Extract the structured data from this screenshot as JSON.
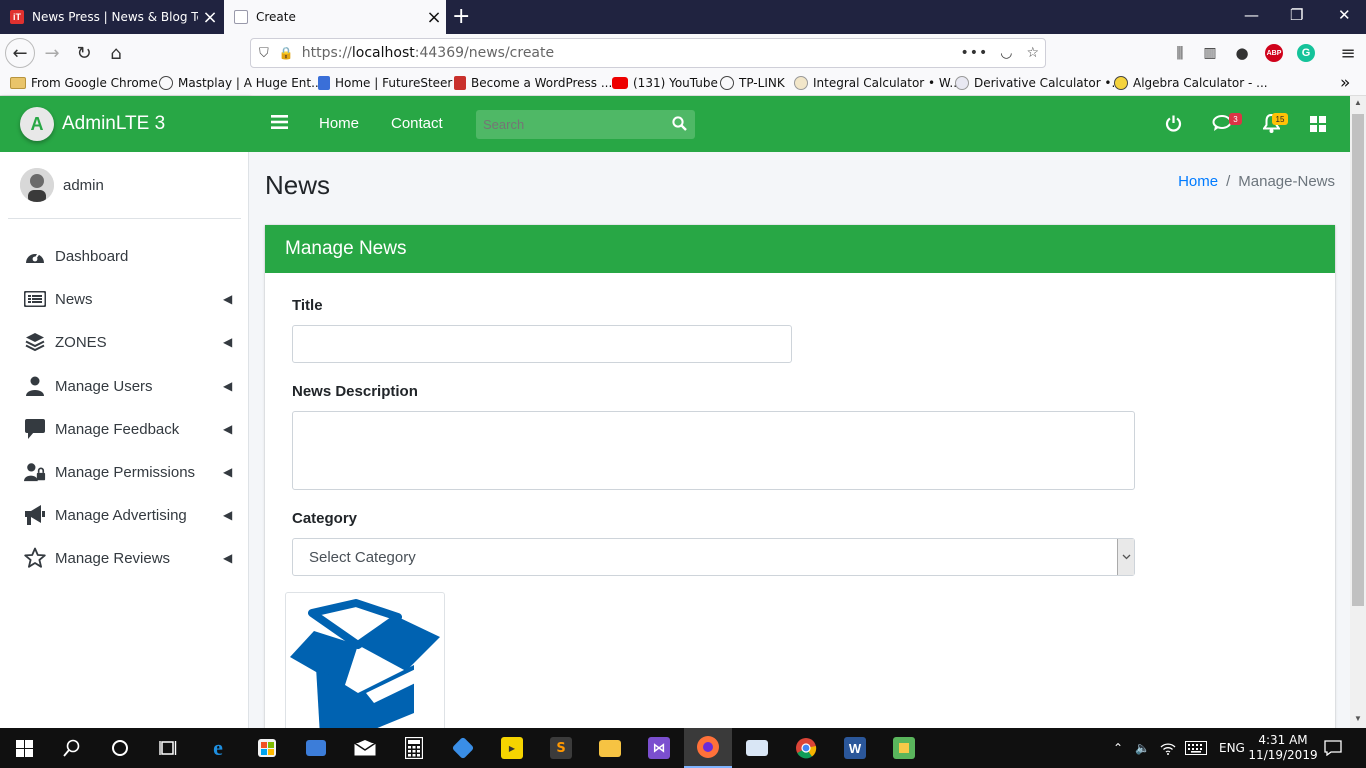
{
  "browser": {
    "tabs": [
      {
        "title": "News Press | News & Blog Tem",
        "active": false
      },
      {
        "title": "Create",
        "active": true
      }
    ],
    "new_tab": "+",
    "window_controls": {
      "minimize": "—",
      "restore": "❐",
      "close": "✕"
    },
    "url": {
      "prefix": "https://",
      "host": "localhost",
      "rest": ":44369/news/create"
    },
    "url_actions": "•••",
    "bookmarks": [
      "From Google Chrome",
      "Mastplay | A Huge Ent...",
      "Home | FutureSteer",
      "Become a WordPress ...",
      "(131) YouTube",
      "TP-LINK",
      "Integral Calculator • W...",
      "Derivative Calculator •...",
      "Algebra Calculator - ..."
    ],
    "bookmarks_more": "»"
  },
  "app": {
    "brand": {
      "logo_letter": "A",
      "name": "AdminLTE 3"
    },
    "user": {
      "name": "admin"
    },
    "menu": [
      {
        "label": "Dashboard",
        "icon": "dashboard-gauge-icon",
        "has_children": false
      },
      {
        "label": "News",
        "icon": "news-list-icon",
        "has_children": true
      },
      {
        "label": "ZONES",
        "icon": "layers-icon",
        "has_children": true
      },
      {
        "label": "Manage Users",
        "icon": "user-icon",
        "has_children": true
      },
      {
        "label": "Manage Feedback",
        "icon": "comment-icon",
        "has_children": true
      },
      {
        "label": "Manage Permissions",
        "icon": "user-lock-icon",
        "has_children": true
      },
      {
        "label": "Manage Advertising",
        "icon": "megaphone-icon",
        "has_children": true
      },
      {
        "label": "Manage Reviews",
        "icon": "star-icon",
        "has_children": true
      }
    ],
    "topnav": {
      "links": [
        "Home",
        "Contact"
      ],
      "search_placeholder": "Search",
      "messages_count": "3",
      "notifications_count": "15"
    },
    "page": {
      "title": "News",
      "breadcrumb": {
        "home": "Home",
        "separator": "/",
        "current": "Manage-News"
      }
    },
    "form": {
      "card_title": "Manage News",
      "title_label": "Title",
      "title_value": "",
      "description_label": "News Description",
      "description_value": "",
      "category_label": "Category",
      "category_selected": "Select Category"
    }
  },
  "taskbar": {
    "language": "ENG",
    "time": "4:31 AM",
    "date": "11/19/2019"
  },
  "colors": {
    "brand_green": "#28a745",
    "link_blue": "#007bff",
    "badge_red": "#dc3545",
    "badge_yellow": "#ffc107",
    "box_blue": "#0062b1"
  }
}
